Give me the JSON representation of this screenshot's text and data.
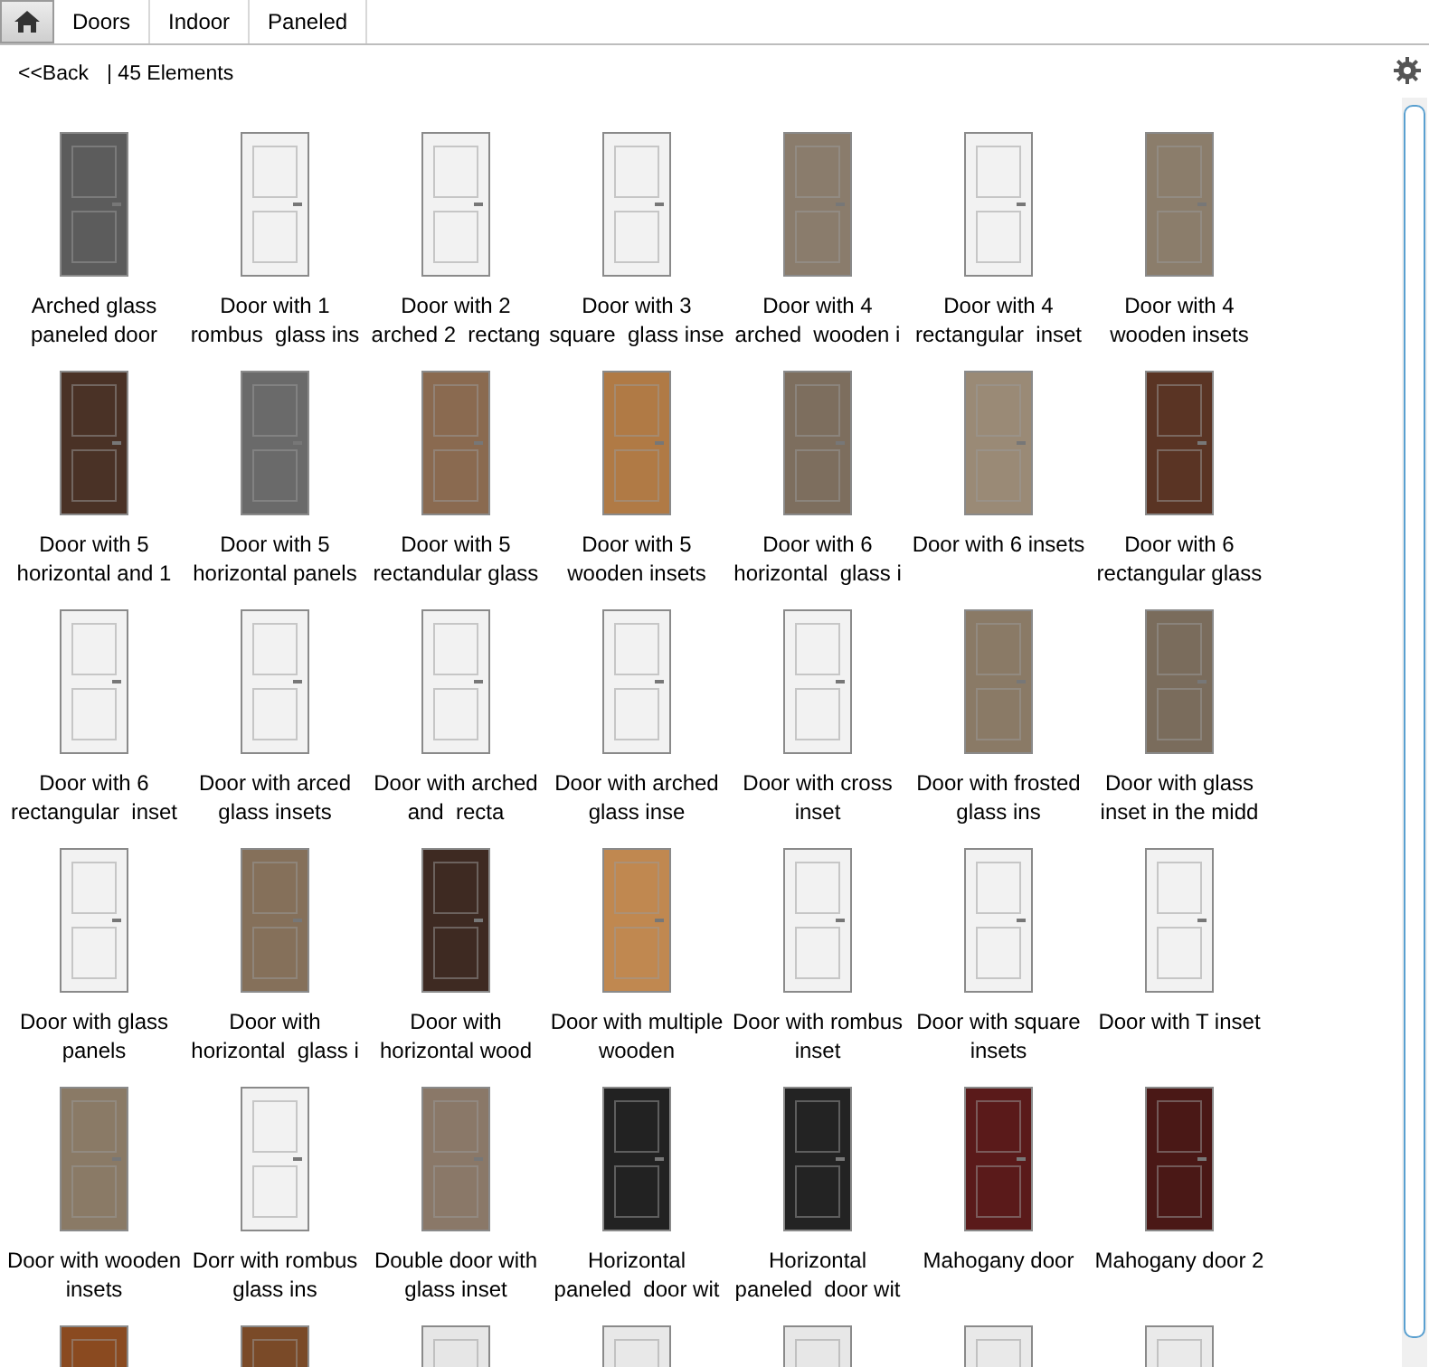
{
  "breadcrumb": [
    {
      "label": "Doors"
    },
    {
      "label": "Indoor"
    },
    {
      "label": "Paneled"
    }
  ],
  "back_link": "<<Back",
  "count": "| 45 Elements",
  "items": [
    {
      "label": "Arched glass paneled door",
      "color": "#5c5c5c"
    },
    {
      "label": "Door with 1 rombus  glass ins",
      "color": "#f2f2f2"
    },
    {
      "label": "Door with 2 arched 2  rectang",
      "color": "#f2f2f2"
    },
    {
      "label": "Door with 3 square  glass inse",
      "color": "#f2f2f2"
    },
    {
      "label": "Door with 4 arched  wooden i",
      "color": "#8a7c6c"
    },
    {
      "label": "Door with 4 rectangular  inset",
      "color": "#f2f2f2"
    },
    {
      "label": "Door with 4 wooden insets",
      "color": "#8b7d6b"
    },
    {
      "label": "Door with 5 horizontal and 1",
      "color": "#4a3226"
    },
    {
      "label": "Door with 5 horizontal panels",
      "color": "#6a6a6a"
    },
    {
      "label": "Door with 5 rectandular glass",
      "color": "#8a6a50"
    },
    {
      "label": "Door with 5 wooden insets",
      "color": "#b07a45"
    },
    {
      "label": "Door with 6 horizontal  glass i",
      "color": "#7d6e5e"
    },
    {
      "label": "Door with 6 insets",
      "color": "#9a8a76"
    },
    {
      "label": "Door with 6 rectangular glass",
      "color": "#5a3424"
    },
    {
      "label": "Door with 6 rectangular  inset",
      "color": "#f2f2f2"
    },
    {
      "label": "Door with arced glass insets",
      "color": "#f2f2f2"
    },
    {
      "label": "Door with arched  and  recta",
      "color": "#f2f2f2"
    },
    {
      "label": "Door with arched  glass inse",
      "color": "#f2f2f2"
    },
    {
      "label": "Door with cross inset",
      "color": "#f2f2f2"
    },
    {
      "label": "Door with frosted  glass ins",
      "color": "#8a7a66"
    },
    {
      "label": "Door with glass inset in the midd",
      "color": "#7a6c5c"
    },
    {
      "label": "Door with glass panels",
      "color": "#f2f2f2"
    },
    {
      "label": "Door with horizontal  glass i",
      "color": "#85705a"
    },
    {
      "label": "Door with horizontal wood",
      "color": "#3e2a22"
    },
    {
      "label": "Door with multiple wooden",
      "color": "#c08850"
    },
    {
      "label": "Door with rombus inset",
      "color": "#f2f2f2"
    },
    {
      "label": "Door with square insets",
      "color": "#f2f2f2"
    },
    {
      "label": "Door with T inset",
      "color": "#f2f2f2"
    },
    {
      "label": "Door with wooden insets",
      "color": "#8a7a66"
    },
    {
      "label": "Dorr with rombus  glass ins",
      "color": "#f2f2f2"
    },
    {
      "label": "Double door with glass inset",
      "color": "#8a7868"
    },
    {
      "label": "Horizontal paneled  door wit",
      "color": "#222222"
    },
    {
      "label": "Horizontal paneled  door wit",
      "color": "#232323"
    },
    {
      "label": "Mahogany door",
      "color": "#5a1a1a"
    },
    {
      "label": "Mahogany door 2",
      "color": "#4a1816"
    },
    {
      "color": "#8a4a20"
    },
    {
      "color": "#7a4a28"
    },
    {
      "color": "#e6e6e6"
    },
    {
      "color": "#e8e8e8"
    },
    {
      "color": "#e7e7e7"
    },
    {
      "color": "#e9e9e9"
    },
    {
      "color": "#eaeaea"
    }
  ]
}
